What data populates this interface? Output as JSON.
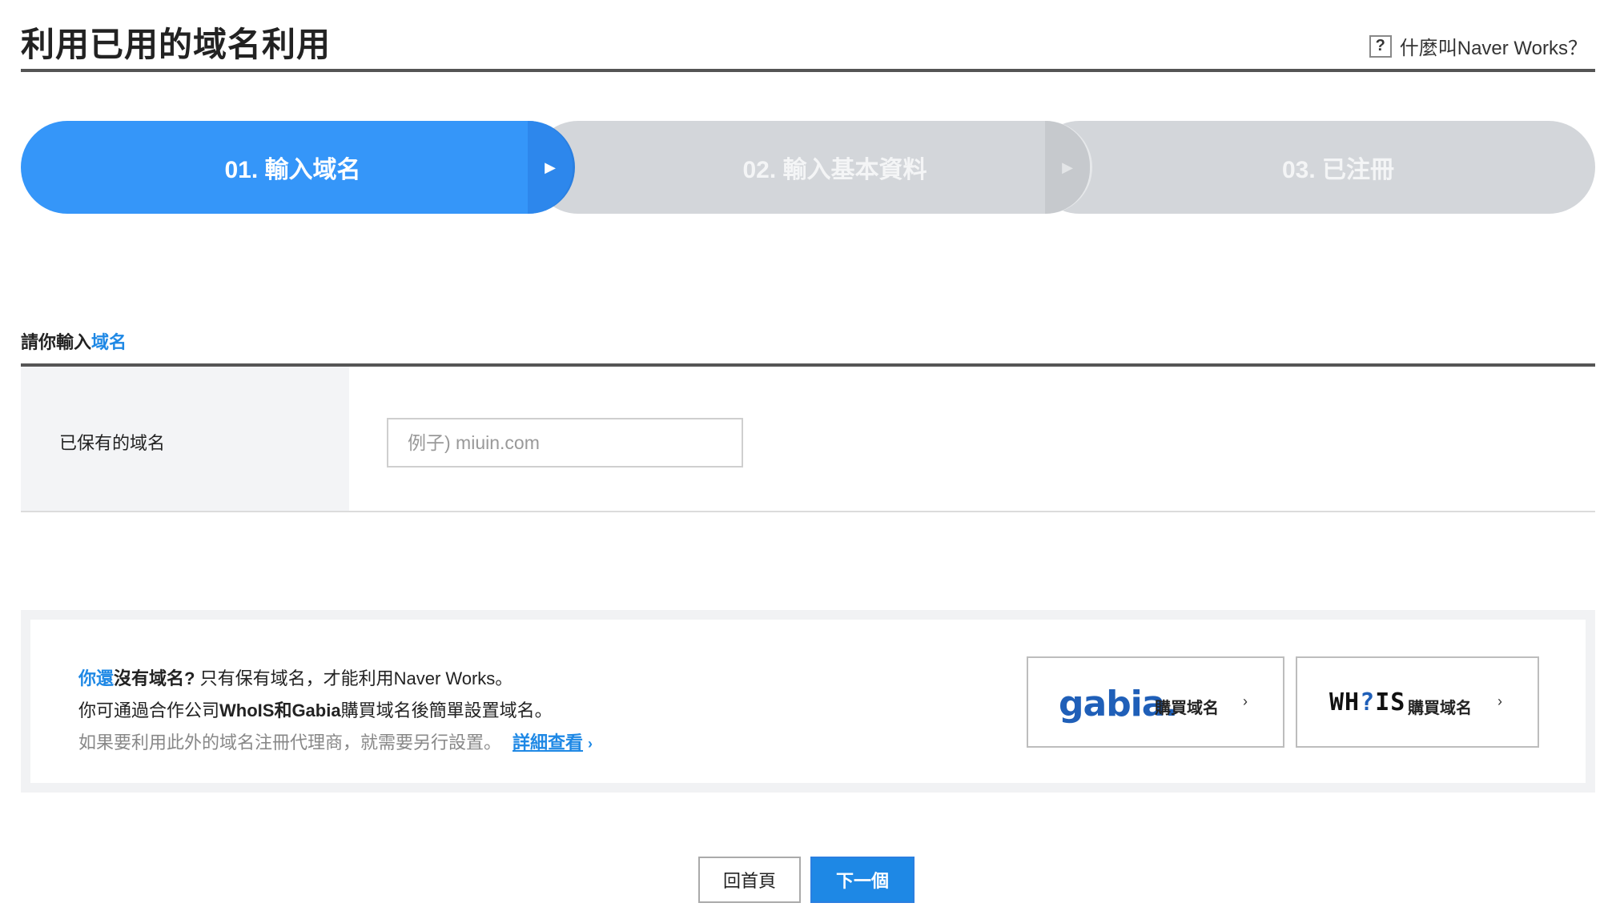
{
  "header": {
    "title": "利用已用的域名利用",
    "help_icon": "?",
    "help_label": "什麼叫Naver Works？"
  },
  "stepper": {
    "steps": [
      {
        "label": "01. 輸入域名",
        "state": "active"
      },
      {
        "label": "02. 輸入基本資料",
        "state": "inactive"
      },
      {
        "label": "03. 已注冊",
        "state": "inactive"
      }
    ],
    "arrow_glyph": "▶"
  },
  "section": {
    "heading_prefix": "請你輸入",
    "heading_accent": "域名"
  },
  "form": {
    "label": "已保有的域名",
    "input_value": "",
    "input_placeholder": "例子) miuin.com"
  },
  "info": {
    "line1_blue": "你還",
    "line1_bold": "沒有域名?",
    "line1_rest": " 只有保有域名，才能利用Naver Works。",
    "line2_a": "你可通過合作公司",
    "line2_b": "WhoIS和Gabia",
    "line2_c": "購買域名後簡單設置域名。",
    "line3_text": "如果要利用此外的域名注冊代理商，就需要另行設置。",
    "line3_link": "詳細查看",
    "link_chevron": "›"
  },
  "buy": {
    "gabia_logo": "gabia.",
    "gabia_label": "購買域名",
    "whois_logo_a": "WH",
    "whois_logo_q": "?",
    "whois_logo_b": "IS",
    "whois_label": "購買域名",
    "chevron": "›"
  },
  "actions": {
    "home_label": "回首頁",
    "next_label": "下一個"
  },
  "colors": {
    "accent": "#1e88e5",
    "step_active": "#3596f9",
    "step_inactive": "#d3d6da"
  }
}
